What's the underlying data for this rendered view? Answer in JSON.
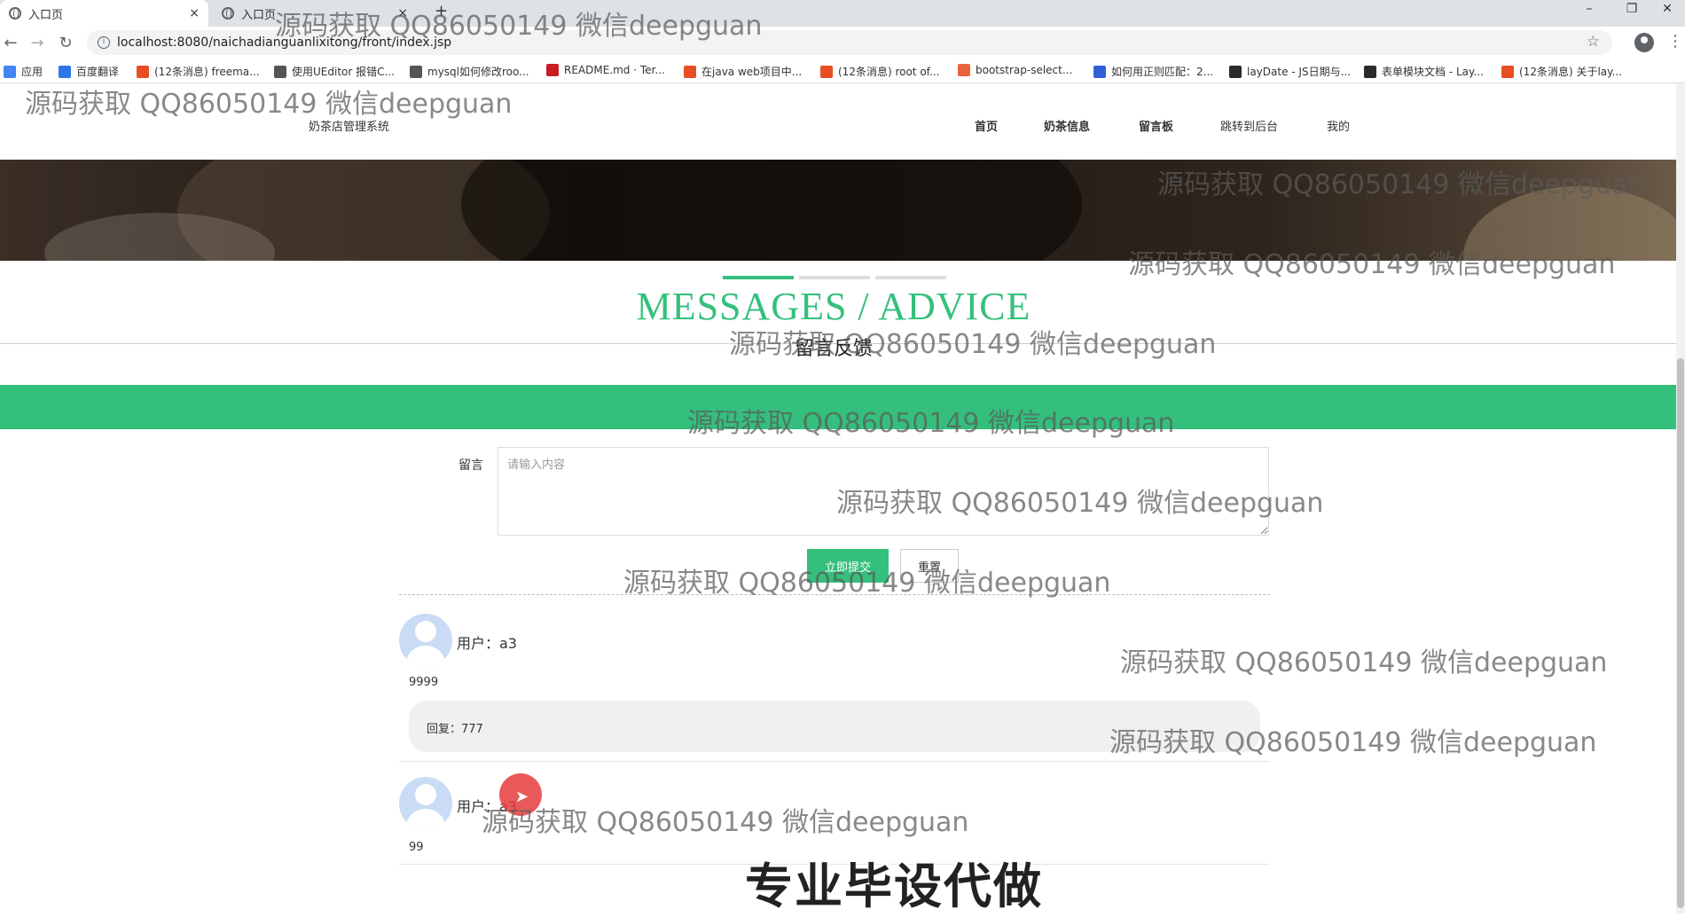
{
  "browser": {
    "tabs": [
      {
        "title": "入口页",
        "close": "×"
      },
      {
        "title": "入口页",
        "close": "×"
      }
    ],
    "new_tab": "+",
    "window_controls": {
      "minimize": "–",
      "restore": "❐",
      "close": "✕"
    },
    "nav": {
      "back": "←",
      "forward": "→",
      "reload": "↻"
    },
    "url": "localhost:8080/naichadianguanlixitong/front/index.jsp",
    "bookmarks": [
      {
        "label": "应用",
        "color": "#4285f4"
      },
      {
        "label": "百度翻译",
        "color": "#2f76e8"
      },
      {
        "label": "(12条消息) freema...",
        "color": "#e84e23"
      },
      {
        "label": "使用UEditor 报错C...",
        "color": "#555555"
      },
      {
        "label": "mysql如何修改roo...",
        "color": "#555555"
      },
      {
        "label": "README.md · Ter...",
        "color": "#c71d23"
      },
      {
        "label": "在java web项目中...",
        "color": "#e84e23"
      },
      {
        "label": "(12条消息) root of...",
        "color": "#e84e23"
      },
      {
        "label": "bootstrap-select...",
        "color": "#e8643c"
      },
      {
        "label": "如何用正则匹配：2...",
        "color": "#3060d8"
      },
      {
        "label": "layDate - JS日期与...",
        "color": "#2b2b2b"
      },
      {
        "label": "表单模块文档 - Lay...",
        "color": "#2b2b2b"
      },
      {
        "label": "(12条消息) 关于lay...",
        "color": "#e84e23"
      }
    ]
  },
  "site": {
    "title": "奶茶店管理系统",
    "nav": [
      "首页",
      "奶茶信息",
      "留言板",
      "跳转到后台",
      "我的"
    ]
  },
  "section": {
    "title": "MESSAGES / ADVICE",
    "subtitle": "留言反馈"
  },
  "form": {
    "label": "留言",
    "placeholder": "请输入内容",
    "submit": "立即提交",
    "reset": "重置"
  },
  "messages": [
    {
      "user_label": "用户：a3",
      "content": "9999",
      "reply": "回复：777"
    },
    {
      "user_label": "用户：a3",
      "content": "99",
      "reply": ""
    }
  ],
  "watermarks": [
    "源码获取 QQ86050149 微信deepguan",
    "源码获取 QQ86050149 微信deepguan",
    "源码获取 QQ86050149 微信deepguan",
    "源码获取 QQ86050149 微信deepguan",
    "源码获取 QQ86050149 微信deepguan",
    "源码获取 QQ86050149 微信deepguan",
    "源码获取 QQ86050149 微信deepguan",
    "源码获取 QQ86050149 微信deepguan",
    "源码获取 QQ86050149 微信deepguan",
    "源码获取 QQ86050149 微信deepguan",
    "源码获取 QQ86050149 微信deepguan"
  ],
  "promo": "专业毕设代做",
  "colors": {
    "accent": "#34c07c",
    "cursor": "#e63c3c"
  }
}
